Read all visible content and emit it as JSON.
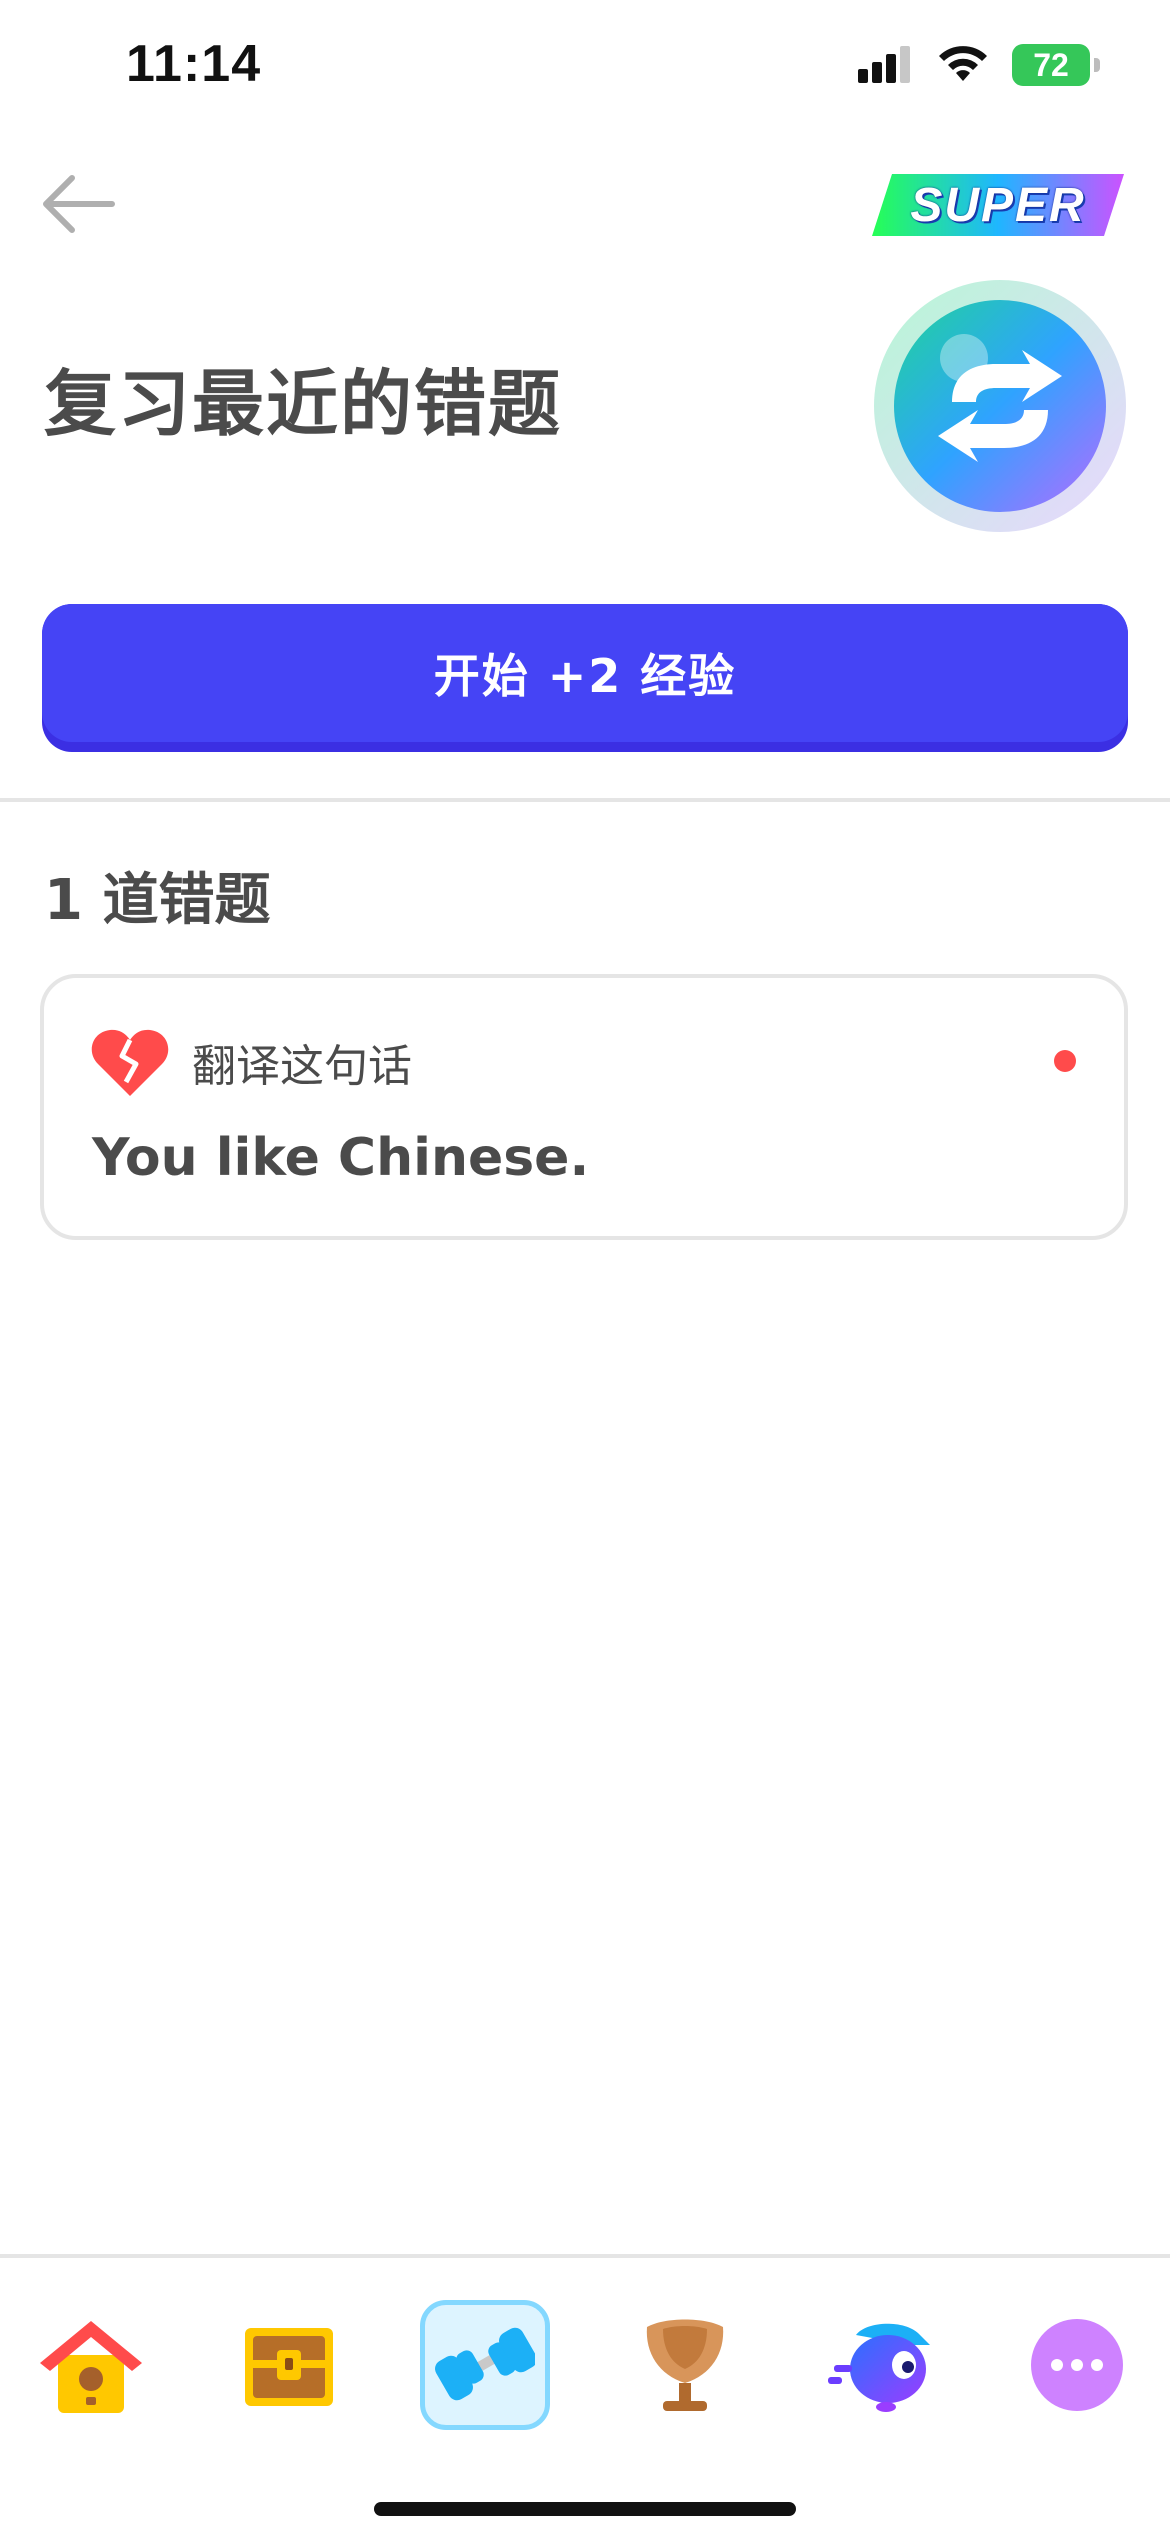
{
  "status_bar": {
    "time": "11:14",
    "battery": "72",
    "icons": [
      "cellular-signal-icon",
      "wifi-icon",
      "battery-charging-icon"
    ]
  },
  "header": {
    "back_icon": "arrow-left-icon",
    "super_label": "SUPER",
    "title": "复习最近的错题",
    "badge_icon": "refresh-arrows-icon"
  },
  "start_button": {
    "label": "开始 +2 经验"
  },
  "mistakes": {
    "section_title": "1 道错题",
    "items": [
      {
        "icon": "broken-heart-icon",
        "type": "翻译这句话",
        "sentence": "You like Chinese.",
        "unread": true
      }
    ]
  },
  "bottom_nav": {
    "items": [
      {
        "icon": "birdhouse-home-icon",
        "active": false
      },
      {
        "icon": "treasure-chest-icon",
        "active": false
      },
      {
        "icon": "dumbbell-icon",
        "active": true
      },
      {
        "icon": "trophy-icon",
        "active": false
      },
      {
        "icon": "duo-character-icon",
        "active": false
      },
      {
        "icon": "more-dots-icon",
        "active": false
      }
    ]
  },
  "colors": {
    "primary_button": "#4544f5",
    "primary_button_shadow": "#3b2fe3",
    "text": "#4b4b4b",
    "border": "#e5e5e5",
    "danger": "#ff4b4b",
    "nav_active_border": "#84d8ff",
    "nav_active_bg": "#ddf4ff"
  }
}
